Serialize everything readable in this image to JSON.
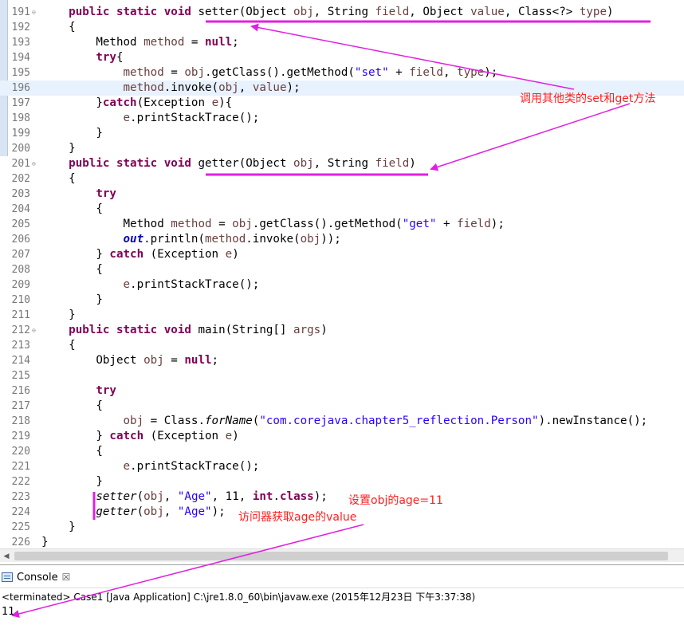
{
  "editor": {
    "lines": [
      {
        "num": "191",
        "fold": true,
        "tokens": [
          [
            "p",
            "    "
          ],
          [
            "k",
            "public static void"
          ],
          [
            "p",
            " setter(Object "
          ],
          [
            "v",
            "obj"
          ],
          [
            "p",
            ", String "
          ],
          [
            "v",
            "field"
          ],
          [
            "p",
            ", Object "
          ],
          [
            "v",
            "value"
          ],
          [
            "p",
            ", Class<?> "
          ],
          [
            "v",
            "type"
          ],
          [
            "p",
            ")"
          ]
        ]
      },
      {
        "num": "192",
        "tokens": [
          [
            "p",
            "    {"
          ]
        ]
      },
      {
        "num": "193",
        "tokens": [
          [
            "p",
            "        Method "
          ],
          [
            "v",
            "method"
          ],
          [
            "p",
            " = "
          ],
          [
            "k",
            "null"
          ],
          [
            "p",
            ";"
          ]
        ]
      },
      {
        "num": "194",
        "tokens": [
          [
            "p",
            "        "
          ],
          [
            "k",
            "try"
          ],
          [
            "p",
            "{"
          ]
        ]
      },
      {
        "num": "195",
        "tokens": [
          [
            "p",
            "            "
          ],
          [
            "v",
            "method"
          ],
          [
            "p",
            " = "
          ],
          [
            "v",
            "obj"
          ],
          [
            "p",
            ".getClass().getMethod("
          ],
          [
            "s",
            "\"set\""
          ],
          [
            "p",
            " + "
          ],
          [
            "v",
            "field"
          ],
          [
            "p",
            ", "
          ],
          [
            "v",
            "type"
          ],
          [
            "p",
            ");"
          ]
        ]
      },
      {
        "num": "196",
        "hl": true,
        "tokens": [
          [
            "p",
            "            "
          ],
          [
            "v",
            "method"
          ],
          [
            "p",
            ".invoke("
          ],
          [
            "v",
            "obj"
          ],
          [
            "p",
            ", "
          ],
          [
            "v",
            "value"
          ],
          [
            "p",
            ");"
          ]
        ]
      },
      {
        "num": "197",
        "tokens": [
          [
            "p",
            "        }"
          ],
          [
            "k",
            "catch"
          ],
          [
            "p",
            "(Exception "
          ],
          [
            "v",
            "e"
          ],
          [
            "p",
            "){"
          ]
        ]
      },
      {
        "num": "198",
        "tokens": [
          [
            "p",
            "            "
          ],
          [
            "v",
            "e"
          ],
          [
            "p",
            ".printStackTrace();"
          ]
        ]
      },
      {
        "num": "199",
        "tokens": [
          [
            "p",
            "        }"
          ]
        ]
      },
      {
        "num": "200",
        "tokens": [
          [
            "p",
            "    }"
          ]
        ]
      },
      {
        "num": "201",
        "fold": true,
        "tokens": [
          [
            "p",
            "    "
          ],
          [
            "k",
            "public static void"
          ],
          [
            "p",
            " getter(Object "
          ],
          [
            "v",
            "obj"
          ],
          [
            "p",
            ", String "
          ],
          [
            "v",
            "field"
          ],
          [
            "p",
            ")"
          ]
        ]
      },
      {
        "num": "202",
        "tokens": [
          [
            "p",
            "    {"
          ]
        ]
      },
      {
        "num": "203",
        "tokens": [
          [
            "p",
            "        "
          ],
          [
            "k",
            "try"
          ]
        ]
      },
      {
        "num": "204",
        "tokens": [
          [
            "p",
            "        {"
          ]
        ]
      },
      {
        "num": "205",
        "tokens": [
          [
            "p",
            "            Method "
          ],
          [
            "v",
            "method"
          ],
          [
            "p",
            " = "
          ],
          [
            "v",
            "obj"
          ],
          [
            "p",
            ".getClass().getMethod("
          ],
          [
            "s",
            "\"get\""
          ],
          [
            "p",
            " + "
          ],
          [
            "v",
            "field"
          ],
          [
            "p",
            ");"
          ]
        ]
      },
      {
        "num": "206",
        "tokens": [
          [
            "p",
            "            "
          ],
          [
            "f",
            "out"
          ],
          [
            "p",
            ".println("
          ],
          [
            "v",
            "method"
          ],
          [
            "p",
            ".invoke("
          ],
          [
            "v",
            "obj"
          ],
          [
            "p",
            "));"
          ]
        ]
      },
      {
        "num": "207",
        "tokens": [
          [
            "p",
            "        } "
          ],
          [
            "k",
            "catch"
          ],
          [
            "p",
            " (Exception "
          ],
          [
            "v",
            "e"
          ],
          [
            "p",
            ")"
          ]
        ]
      },
      {
        "num": "208",
        "tokens": [
          [
            "p",
            "        {"
          ]
        ]
      },
      {
        "num": "209",
        "tokens": [
          [
            "p",
            "            "
          ],
          [
            "v",
            "e"
          ],
          [
            "p",
            ".printStackTrace();"
          ]
        ]
      },
      {
        "num": "210",
        "tokens": [
          [
            "p",
            "        }"
          ]
        ]
      },
      {
        "num": "211",
        "tokens": [
          [
            "p",
            "    }"
          ]
        ]
      },
      {
        "num": "212",
        "fold": true,
        "tokens": [
          [
            "p",
            "    "
          ],
          [
            "k",
            "public static void"
          ],
          [
            "p",
            " main(String[] "
          ],
          [
            "v",
            "args"
          ],
          [
            "p",
            ")"
          ]
        ]
      },
      {
        "num": "213",
        "tokens": [
          [
            "p",
            "    {"
          ]
        ]
      },
      {
        "num": "214",
        "tokens": [
          [
            "p",
            "        Object "
          ],
          [
            "v",
            "obj"
          ],
          [
            "p",
            " = "
          ],
          [
            "k",
            "null"
          ],
          [
            "p",
            ";"
          ]
        ]
      },
      {
        "num": "215",
        "tokens": []
      },
      {
        "num": "216",
        "tokens": [
          [
            "p",
            "        "
          ],
          [
            "k",
            "try"
          ]
        ]
      },
      {
        "num": "217",
        "tokens": [
          [
            "p",
            "        {"
          ]
        ]
      },
      {
        "num": "218",
        "tokens": [
          [
            "p",
            "            "
          ],
          [
            "v",
            "obj"
          ],
          [
            "p",
            " = Class."
          ],
          [
            "i",
            "forName"
          ],
          [
            "p",
            "("
          ],
          [
            "s",
            "\"com.corejava.chapter5_reflection.Person\""
          ],
          [
            "p",
            ").newInstance();"
          ]
        ]
      },
      {
        "num": "219",
        "tokens": [
          [
            "p",
            "        } "
          ],
          [
            "k",
            "catch"
          ],
          [
            "p",
            " (Exception "
          ],
          [
            "v",
            "e"
          ],
          [
            "p",
            ")"
          ]
        ]
      },
      {
        "num": "220",
        "tokens": [
          [
            "p",
            "        {"
          ]
        ]
      },
      {
        "num": "221",
        "tokens": [
          [
            "p",
            "            "
          ],
          [
            "v",
            "e"
          ],
          [
            "p",
            ".printStackTrace();"
          ]
        ]
      },
      {
        "num": "222",
        "tokens": [
          [
            "p",
            "        }"
          ]
        ]
      },
      {
        "num": "223",
        "tokens": [
          [
            "p",
            "        "
          ],
          [
            "i",
            "setter"
          ],
          [
            "p",
            "("
          ],
          [
            "v",
            "obj"
          ],
          [
            "p",
            ", "
          ],
          [
            "s",
            "\"Age\""
          ],
          [
            "p",
            ", 11, "
          ],
          [
            "k",
            "int"
          ],
          [
            "p",
            "."
          ],
          [
            "k",
            "class"
          ],
          [
            "p",
            ");"
          ]
        ]
      },
      {
        "num": "224",
        "tokens": [
          [
            "p",
            "        "
          ],
          [
            "i",
            "getter"
          ],
          [
            "p",
            "("
          ],
          [
            "v",
            "obj"
          ],
          [
            "p",
            ", "
          ],
          [
            "s",
            "\"Age\""
          ],
          [
            "p",
            ");"
          ]
        ]
      },
      {
        "num": "225",
        "tokens": [
          [
            "p",
            "    }"
          ]
        ]
      },
      {
        "num": "226",
        "tokens": [
          [
            "p",
            "}"
          ]
        ]
      }
    ]
  },
  "annotations": {
    "accessor_note": "调用其他类的set和get方法",
    "setter_note": "设置obj的age=11",
    "getter_note": "访问器获取age的value"
  },
  "console": {
    "tab_label": "Console",
    "close_glyph": "☒",
    "status": "<terminated> Case1 [Java Application] C:\\jre1.8.0_60\\bin\\javaw.exe (2015年12月23日 下午3:37:38)",
    "output": "11"
  },
  "colors": {
    "keyword": "#7f0055",
    "string": "#2a00ff",
    "variable": "#6a3e3e",
    "field": "#0000c0",
    "annotation": "#ff2020",
    "marker": "#e020e0",
    "current_line": "#e8f2fe"
  }
}
